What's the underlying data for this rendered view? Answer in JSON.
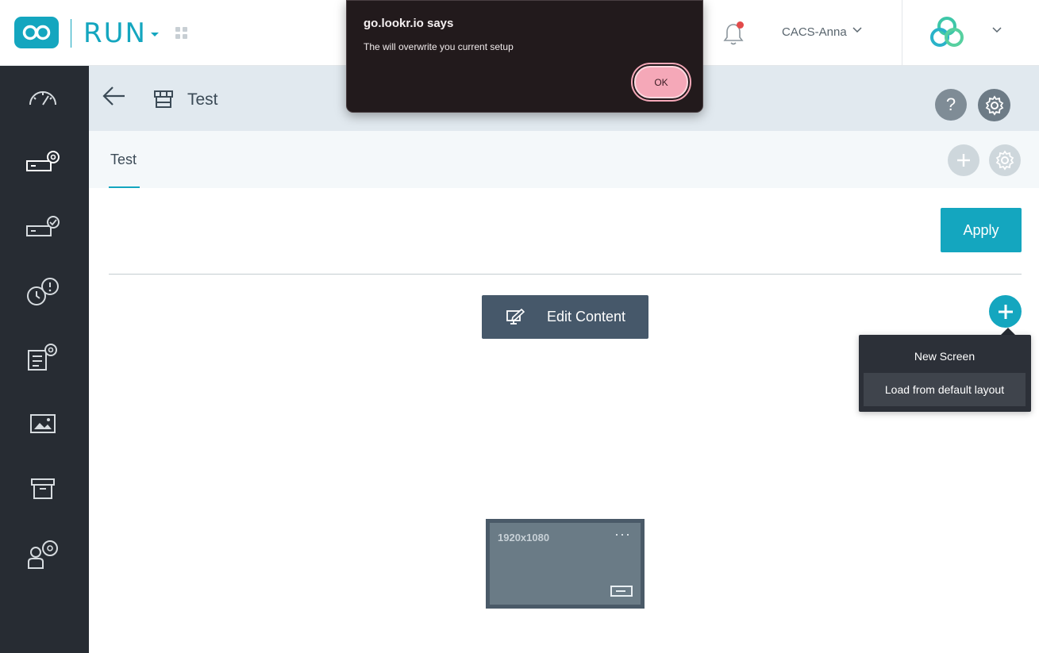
{
  "topbar": {
    "app_name": "RUN",
    "user_name": "CACS-Anna",
    "logo_icon": "infinity-logo-icon",
    "brand_icon": "brand-rings-icon",
    "accent_color": "#14a6bf"
  },
  "sidebar": {
    "items": [
      {
        "icon": "dashboard-gauge-icon"
      },
      {
        "icon": "device-settings-icon"
      },
      {
        "icon": "device-check-icon"
      },
      {
        "icon": "alert-clock-icon"
      },
      {
        "icon": "content-settings-icon"
      },
      {
        "icon": "media-image-icon"
      },
      {
        "icon": "archive-icon"
      },
      {
        "icon": "user-settings-icon"
      }
    ]
  },
  "header": {
    "title": "Test",
    "help_label": "?"
  },
  "tabs": [
    {
      "label": "Test",
      "active": true
    }
  ],
  "content": {
    "apply_label": "Apply",
    "edit_content_label": "Edit Content",
    "menu": {
      "items": [
        {
          "label": "New Screen"
        },
        {
          "label": "Load from default layout"
        }
      ]
    },
    "screen": {
      "resolution": "1920x1080",
      "more_label": "···"
    }
  },
  "dialog": {
    "title": "go.lookr.io says",
    "message": "The will overwrite you current setup",
    "ok_label": "OK",
    "ok_color": "#f5a8b8"
  }
}
